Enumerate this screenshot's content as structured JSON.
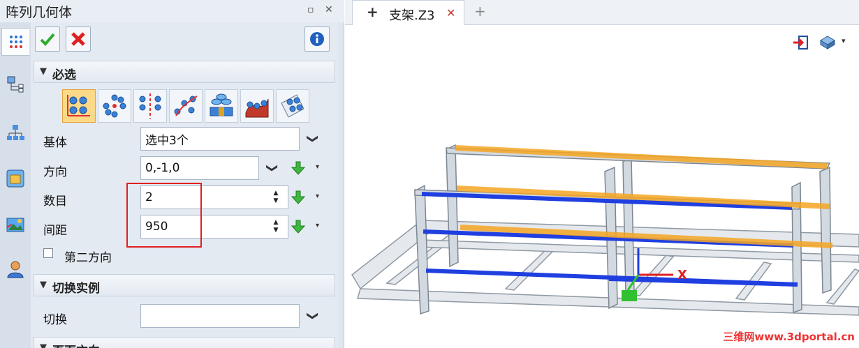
{
  "panel": {
    "title": "阵列几何体",
    "title_controls": [
      "▫",
      "✕"
    ],
    "side_tabs": [
      "pattern-tab-icon",
      "tree-tab-icon",
      "hierarchy-tab-icon",
      "view-tab-icon",
      "image-tab-icon",
      "user-tab-icon"
    ],
    "toolbar": {
      "ok_icon": "check-icon",
      "cancel_icon": "cancel-icon",
      "info_icon": "info-icon"
    }
  },
  "sections": {
    "required": {
      "title": "必选",
      "arrow": "▼"
    },
    "switch": {
      "title": "切换实例",
      "arrow": "▼"
    },
    "next_title": "页面方向"
  },
  "pattern_types": [
    "linear",
    "circular",
    "mirror-linear",
    "scatter",
    "table",
    "curve",
    "fill"
  ],
  "fields": {
    "base": {
      "label": "基体",
      "value": "选中3个"
    },
    "direction": {
      "label": "方向",
      "value": "0,-1,0"
    },
    "count": {
      "label": "数目",
      "value": "2"
    },
    "spacing": {
      "label": "间距",
      "value": "950"
    },
    "second_direction": {
      "label": "第二方向",
      "checked": false
    },
    "switch": {
      "label": "切换",
      "value": ""
    }
  },
  "controls": {
    "chevron": "❯",
    "spin_up": "▲",
    "spin_down": "▼",
    "dropdown": "▾"
  },
  "viewport": {
    "tab": {
      "label": "支架.Z3",
      "pin": "+",
      "close": "✕"
    },
    "new_tab": "+",
    "axis_label": "X",
    "view_icons": [
      "exit-icon",
      "render-icon"
    ],
    "dropdown": "▾"
  },
  "watermark": "三维网www.3dportal.cn",
  "colors": {
    "highlight": "#f5a623",
    "selected_beam": "#1f3fe0",
    "frame": "#9ea7b0",
    "annotation_red": "#e02020"
  }
}
